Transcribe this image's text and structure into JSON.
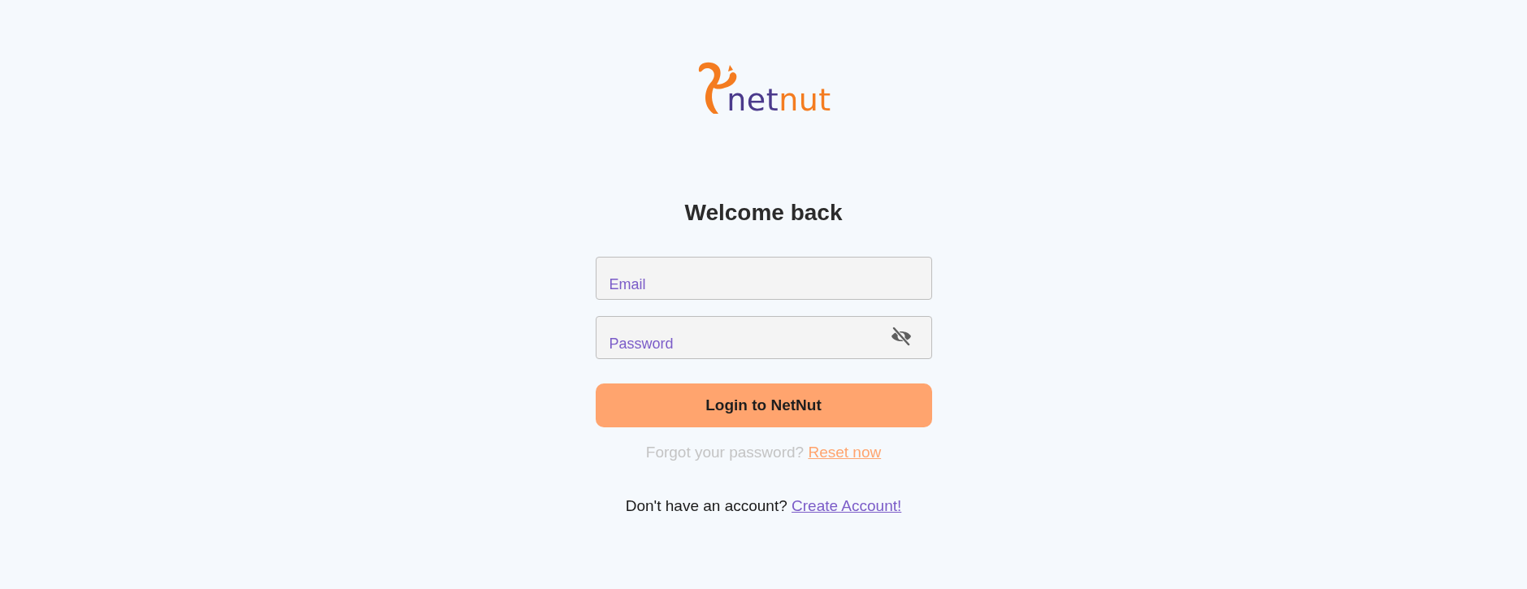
{
  "logo": {
    "part_1": "net",
    "part_2": "nut"
  },
  "heading": "Welcome back",
  "fields": [
    {
      "kind": "text",
      "placeholder": "Email"
    },
    {
      "kind": "password",
      "placeholder": "Password"
    }
  ],
  "login_button": "Login to NetNut",
  "forgot": {
    "text": "Forgot your password?",
    "link": "Reset now"
  },
  "signup": {
    "text": "Don't have an account?",
    "link": "Create Account!"
  }
}
